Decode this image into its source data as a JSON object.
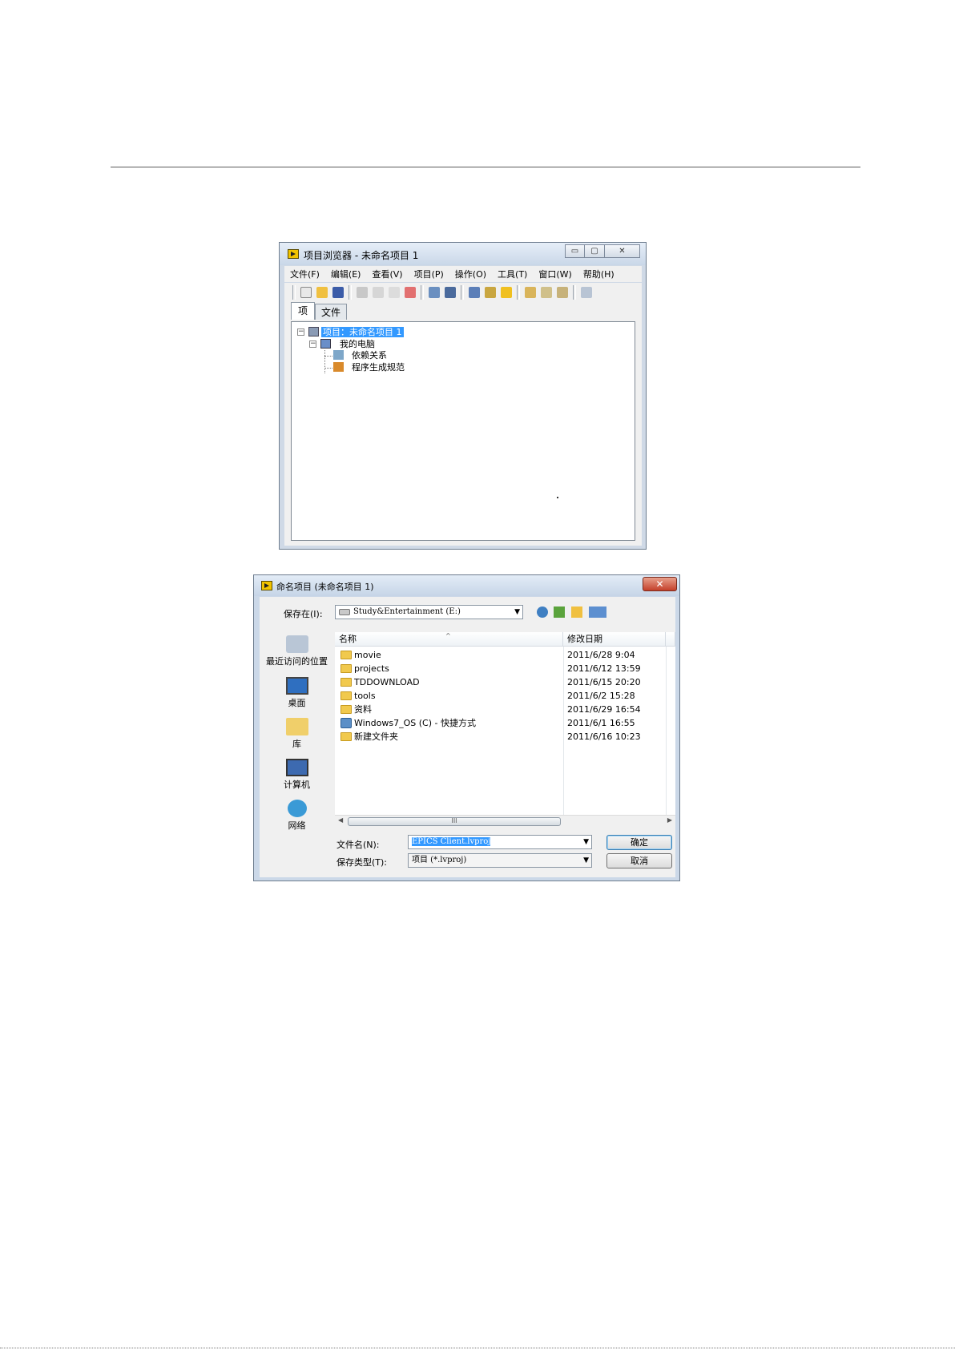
{
  "project_browser": {
    "title": "项目浏览器 - 未命名项目 1",
    "window_controls": [
      "▭",
      "▢",
      "✕"
    ],
    "menu": [
      "文件(F)",
      "编辑(E)",
      "查看(V)",
      "项目(P)",
      "操作(O)",
      "工具(T)",
      "窗口(W)",
      "帮助(H)"
    ],
    "tabs": [
      "项",
      "文件"
    ],
    "tree": {
      "root": "项目：未命名项目 1",
      "computer": "我的电脑",
      "dependencies": "依赖关系",
      "build_specs": "程序生成规范"
    }
  },
  "save_dialog": {
    "title": "命名项目 (未命名项目 1)",
    "close": "✕",
    "save_in_label": "保存在(I):",
    "save_in_value": "Study&Entertainment (E:)",
    "places": [
      "最近访问的位置",
      "桌面",
      "库",
      "计算机",
      "网络"
    ],
    "columns": {
      "name": "名称",
      "date": "修改日期"
    },
    "files": [
      {
        "name": "movie",
        "date": "2011/6/28 9:04",
        "type": "folder"
      },
      {
        "name": "projects",
        "date": "2011/6/12 13:59",
        "type": "folder"
      },
      {
        "name": "TDDOWNLOAD",
        "date": "2011/6/15 20:20",
        "type": "folder"
      },
      {
        "name": "tools",
        "date": "2011/6/2 15:28",
        "type": "folder"
      },
      {
        "name": "资料",
        "date": "2011/6/29 16:54",
        "type": "folder"
      },
      {
        "name": "Windows7_OS (C) - 快捷方式",
        "date": "2011/6/1 16:55",
        "type": "shortcut"
      },
      {
        "name": "新建文件夹",
        "date": "2011/6/16 10:23",
        "type": "folder"
      }
    ],
    "filename_label": "文件名(N):",
    "filename_value": "EPICS Client.lvproj",
    "filetype_label": "保存类型(T):",
    "filetype_value": "项目 (*.lvproj)",
    "ok_label": "确定",
    "cancel_label": "取消",
    "scroll_grip": "III"
  },
  "colors": {
    "selection": "#3399ff",
    "frame": "#cfd9e6",
    "folder": "#f1c94d"
  }
}
